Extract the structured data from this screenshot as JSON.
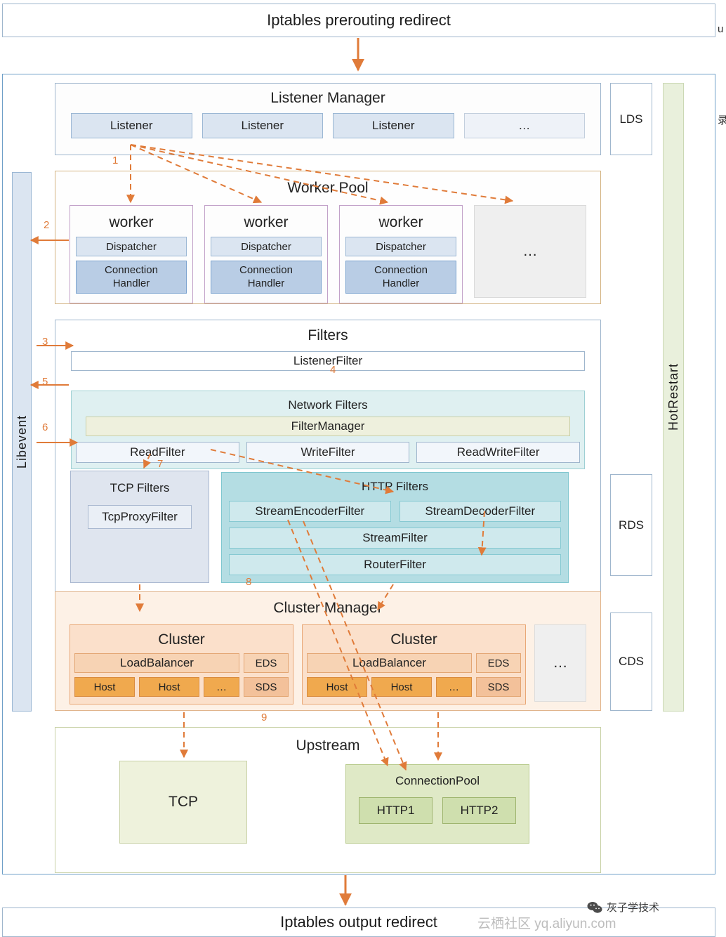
{
  "diagram": {
    "top_bar": "Iptables  prerouting redirect",
    "bottom_bar": "Iptables  output redirect",
    "listener_manager": {
      "title": "Listener Manager",
      "listeners": [
        "Listener",
        "Listener",
        "Listener",
        "…"
      ]
    },
    "lds": "LDS",
    "rds": "RDS",
    "cds": "CDS",
    "hot_restart": "HotRestart",
    "libevent": "Libevent",
    "worker_pool": {
      "title": "Worker Pool",
      "workers": [
        {
          "name": "worker",
          "dispatcher": "Dispatcher",
          "handler": "Connection\nHandler"
        },
        {
          "name": "worker",
          "dispatcher": "Dispatcher",
          "handler": "Connection\nHandler"
        },
        {
          "name": "worker",
          "dispatcher": "Dispatcher",
          "handler": "Connection\nHandler"
        }
      ],
      "more": "…"
    },
    "filters": {
      "title": "Filters",
      "listener_filter": "ListenerFilter",
      "network_filters": {
        "title": "Network Filters",
        "filter_manager": "FilterManager",
        "items": [
          "ReadFilter",
          "WriteFilter",
          "ReadWriteFilter"
        ]
      },
      "tcp_filters": {
        "title": "TCP Filters",
        "items": [
          "TcpProxyFilter"
        ]
      },
      "http_filters": {
        "title": "HTTP Filters",
        "items": [
          "StreamEncoderFilter",
          "StreamDecoderFilter",
          "StreamFilter",
          "RouterFilter"
        ]
      }
    },
    "cluster_manager": {
      "title": "Cluster Manager",
      "clusters": [
        {
          "title": "Cluster",
          "load_balancer": "LoadBalancer",
          "hosts": [
            "Host",
            "Host",
            "…"
          ],
          "eds": "EDS",
          "sds": "SDS"
        },
        {
          "title": "Cluster",
          "load_balancer": "LoadBalancer",
          "hosts": [
            "Host",
            "Host",
            "…"
          ],
          "eds": "EDS",
          "sds": "SDS"
        }
      ],
      "more": "…"
    },
    "upstream": {
      "title": "Upstream",
      "tcp": "TCP",
      "connection_pool": {
        "title": "ConnectionPool",
        "items": [
          "HTTP1",
          "HTTP2"
        ]
      }
    },
    "step_numbers": [
      "1",
      "2",
      "3",
      "4",
      "5",
      "6",
      "7",
      "8",
      "9"
    ],
    "watermark": "云栖社区 yq.aliyun.com",
    "wechat_badge": "灰子学技术",
    "edge_text": [
      "u",
      "录"
    ]
  }
}
